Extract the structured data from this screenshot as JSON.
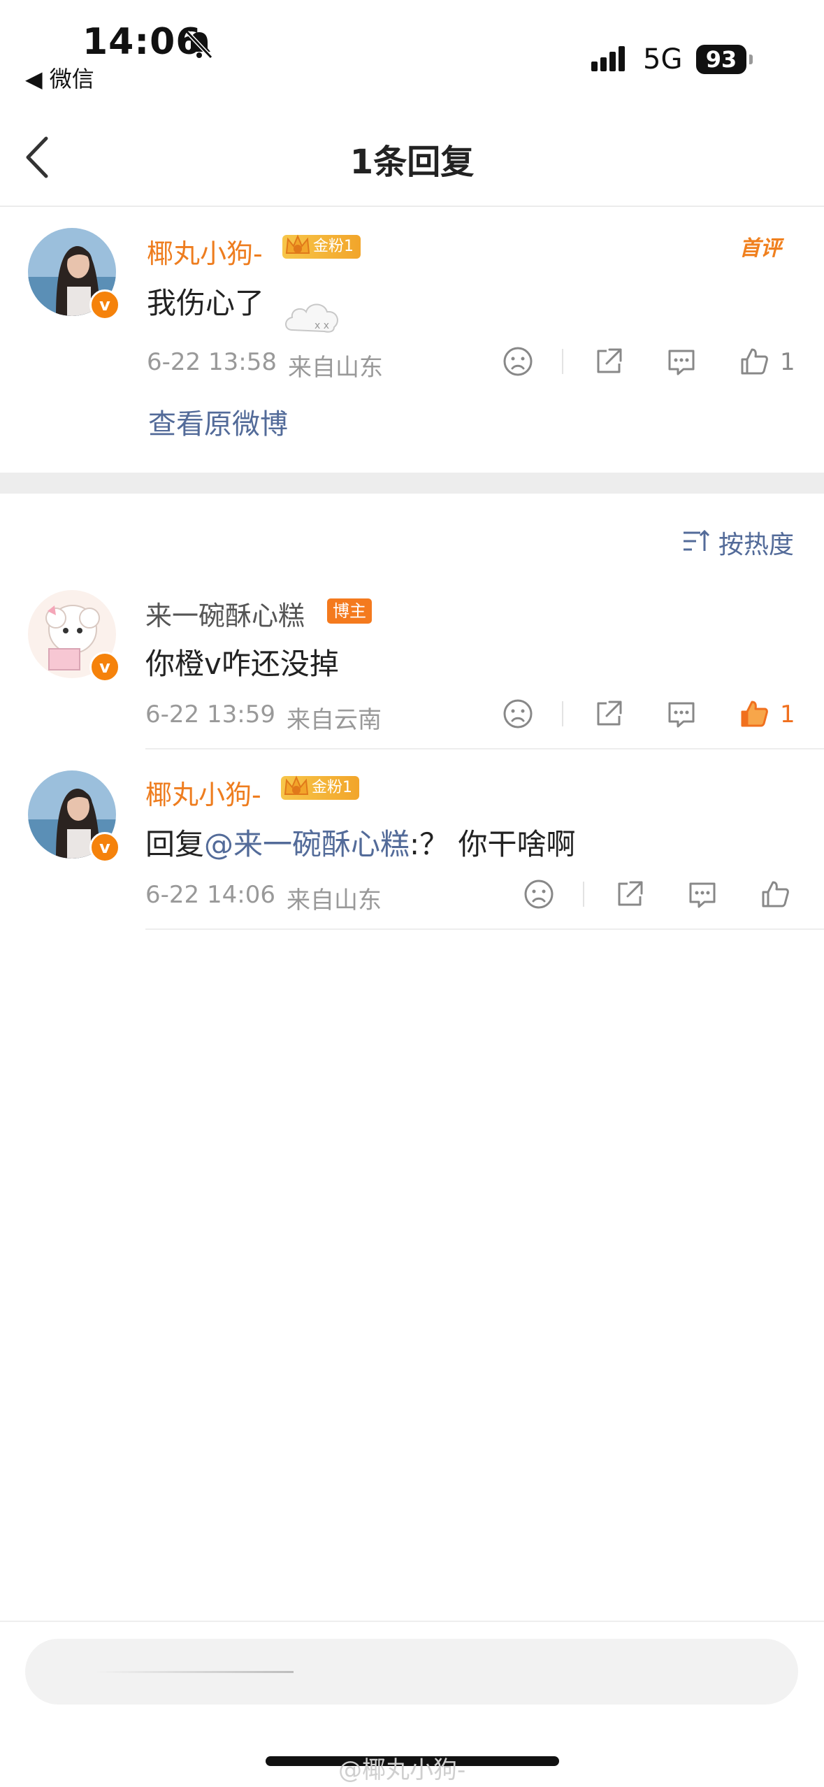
{
  "status_bar": {
    "time": "14:06",
    "back_app": "◀ 微信",
    "network": "5G",
    "battery": "93"
  },
  "nav": {
    "title": "1条回复"
  },
  "main_comment": {
    "username": "椰丸小狗-",
    "fans_badge": "金粉1",
    "first_tag": "首评",
    "text": "我伤心了",
    "timestamp": "6-22 13:58",
    "location": "来自山东",
    "likes": "1",
    "view_original": "查看原微博"
  },
  "sort_label": "按热度",
  "replies": [
    {
      "username": "来一碗酥心糕",
      "badge": "博主",
      "text": "你橙v咋还没掉",
      "timestamp": "6-22 13:59",
      "location": "来自云南",
      "likes": "1"
    },
    {
      "username": "椰丸小狗-",
      "fans_badge": "金粉1",
      "text_prefix": "回复",
      "mention": "@来一碗酥心糕",
      "text_suffix": ":？ 你干啥啊",
      "timestamp": "6-22 14:06",
      "location": "来自山东"
    }
  ],
  "watermark": "@椰丸小狗-",
  "colors": {
    "accent_orange": "#ee7d1f",
    "link_blue": "#536b99",
    "liked_orange": "#f0701e"
  }
}
